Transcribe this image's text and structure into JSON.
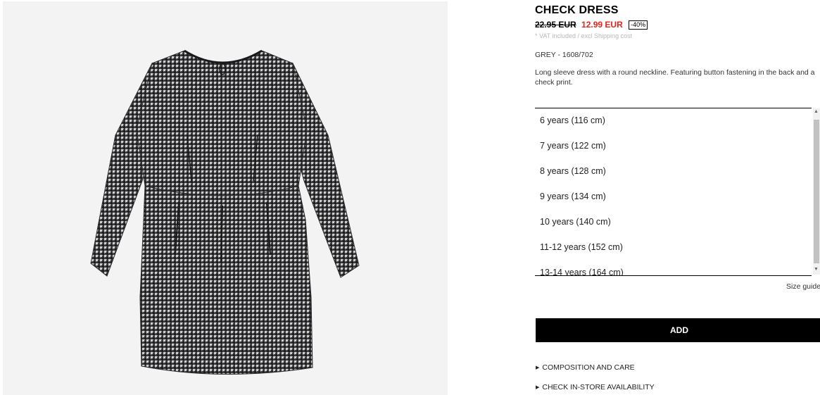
{
  "product": {
    "title": "CHECK DRESS",
    "price_old": "22.95 EUR",
    "price_new": "12.99 EUR",
    "discount": "-40%",
    "vat_note": "* VAT included / excl Shipping cost",
    "color_ref": "GREY - 1608/702",
    "description": "Long sleeve dress with a round neckline. Featuring button fastening in the back and a check print."
  },
  "sizes": [
    "6 years (116 cm)",
    "7 years (122 cm)",
    "8 years (128 cm)",
    "9 years (134 cm)",
    "10 years (140 cm)",
    "11-12 years (152 cm)",
    "13-14 years (164 cm)"
  ],
  "size_guide_label": "Size guide",
  "add_label": "ADD",
  "links": {
    "composition": "COMPOSITION AND CARE",
    "availability": "CHECK IN-STORE AVAILABILITY"
  },
  "icons": {
    "scroll_up": "triangle-up",
    "scroll_down": "triangle-down",
    "expand": "triangle-right"
  },
  "colors": {
    "sale_price": "#e1251b",
    "button_bg": "#000000",
    "image_bg": "#f3f3f3"
  }
}
